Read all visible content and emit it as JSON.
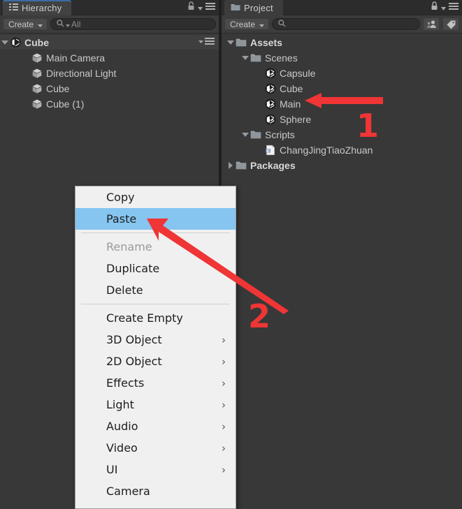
{
  "colors": {
    "panel_bg": "#383838",
    "tab_bg": "#3c3c3c",
    "tab_active_accent": "#3a6ea5",
    "toolbar_bg": "#3c3c3c",
    "text": "#c9c9c9",
    "menu_bg": "#f0f0f0",
    "menu_text": "#1d1d1d",
    "menu_disabled_text": "#9a9a9a",
    "menu_highlight": "#86c5f0",
    "annotation_red": "#ef3535"
  },
  "hierarchy": {
    "tab": {
      "label": "Hierarchy",
      "icon": "hierarchy-list-icon",
      "active": true
    },
    "header_icons": [
      {
        "name": "lock-icon",
        "glyph": "lock"
      },
      {
        "name": "panel-menu-icon",
        "glyph": "hamburger"
      }
    ],
    "toolbar": {
      "create_label": "Create",
      "create_arrow": "chevron-down-icon",
      "search_icon": "search-icon",
      "search_filter_label": "All",
      "search_placeholder": "",
      "search_value": ""
    },
    "scene": {
      "label": "Cube",
      "icon": "unity-scene-icon",
      "expanded": true,
      "menu_icon": "scene-menu-icon"
    },
    "objects": [
      {
        "label": "Main Camera",
        "icon": "gameobject-cube-icon"
      },
      {
        "label": "Directional Light",
        "icon": "gameobject-cube-icon"
      },
      {
        "label": "Cube",
        "icon": "gameobject-cube-icon"
      },
      {
        "label": "Cube (1)",
        "icon": "gameobject-cube-icon"
      }
    ]
  },
  "project": {
    "tab": {
      "label": "Project",
      "icon": "folder-icon",
      "active": false
    },
    "header_icons": [
      {
        "name": "lock-icon",
        "glyph": "lock"
      },
      {
        "name": "panel-menu-icon",
        "glyph": "hamburger"
      }
    ],
    "toolbar": {
      "create_label": "Create",
      "create_arrow": "chevron-down-icon",
      "search_icon": "search-icon",
      "search_placeholder": "",
      "search_value": "",
      "buttons": [
        {
          "name": "collab-icon",
          "label": ""
        },
        {
          "name": "label-tag-icon",
          "label": ""
        }
      ]
    },
    "tree": [
      {
        "label": "Assets",
        "icon": "folder-icon",
        "depth": 0,
        "expanded": true,
        "bold": true
      },
      {
        "label": "Scenes",
        "icon": "folder-icon",
        "depth": 1,
        "expanded": true,
        "bold": false
      },
      {
        "label": "Capsule",
        "icon": "unity-scene-icon",
        "depth": 2,
        "expanded": null,
        "bold": false
      },
      {
        "label": "Cube",
        "icon": "unity-scene-icon",
        "depth": 2,
        "expanded": null,
        "bold": false
      },
      {
        "label": "Main",
        "icon": "unity-scene-icon",
        "depth": 2,
        "expanded": null,
        "bold": false
      },
      {
        "label": "Sphere",
        "icon": "unity-scene-icon",
        "depth": 2,
        "expanded": null,
        "bold": false
      },
      {
        "label": "Scripts",
        "icon": "folder-icon",
        "depth": 1,
        "expanded": true,
        "bold": false
      },
      {
        "label": "ChangJingTiaoZhuan",
        "icon": "csharp-script-icon",
        "depth": 2,
        "expanded": null,
        "bold": false
      },
      {
        "label": "Packages",
        "icon": "folder-icon",
        "depth": 0,
        "expanded": false,
        "bold": true
      }
    ]
  },
  "context_menu": {
    "groups": [
      {
        "items": [
          {
            "label": "Copy",
            "state": "normal",
            "submenu": false
          },
          {
            "label": "Paste",
            "state": "selected",
            "submenu": false
          }
        ]
      },
      {
        "items": [
          {
            "label": "Rename",
            "state": "disabled",
            "submenu": false
          },
          {
            "label": "Duplicate",
            "state": "normal",
            "submenu": false
          },
          {
            "label": "Delete",
            "state": "normal",
            "submenu": false
          }
        ]
      },
      {
        "items": [
          {
            "label": "Create Empty",
            "state": "normal",
            "submenu": false
          },
          {
            "label": "3D Object",
            "state": "normal",
            "submenu": true
          },
          {
            "label": "2D Object",
            "state": "normal",
            "submenu": true
          },
          {
            "label": "Effects",
            "state": "normal",
            "submenu": true
          },
          {
            "label": "Light",
            "state": "normal",
            "submenu": true
          },
          {
            "label": "Audio",
            "state": "normal",
            "submenu": true
          },
          {
            "label": "Video",
            "state": "normal",
            "submenu": true
          },
          {
            "label": "UI",
            "state": "normal",
            "submenu": true
          },
          {
            "label": "Camera",
            "state": "normal",
            "submenu": false
          }
        ]
      }
    ],
    "submenu_glyph": "›"
  },
  "annotations": [
    {
      "name": "annotation-1",
      "number": "1",
      "target": "project-cube-scene-asset"
    },
    {
      "name": "annotation-2",
      "number": "2",
      "target": "context-menu-paste"
    }
  ]
}
